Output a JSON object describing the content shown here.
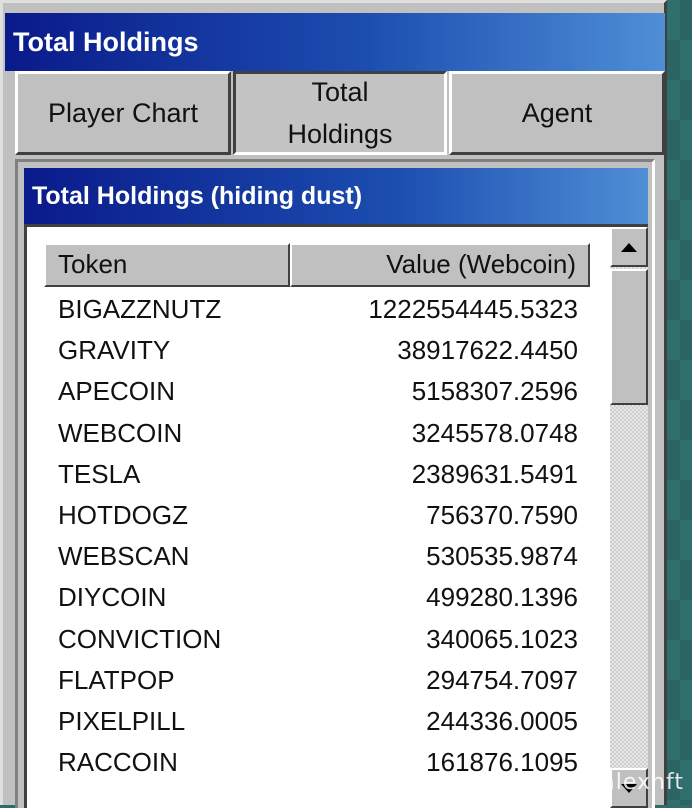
{
  "window": {
    "title": "Total Holdings"
  },
  "tabs": [
    {
      "label": "Player Chart"
    },
    {
      "label": "Total Holdings"
    },
    {
      "label": "Agent"
    }
  ],
  "panel": {
    "title": "Total Holdings (hiding dust)"
  },
  "table": {
    "columns": [
      "Token",
      "Value (Webcoin)"
    ],
    "rows": [
      {
        "token": "BIGAZZNUTZ",
        "value": "1222554445.5323"
      },
      {
        "token": "GRAVITY",
        "value": "38917622.4450"
      },
      {
        "token": "APECOIN",
        "value": "5158307.2596"
      },
      {
        "token": "WEBCOIN",
        "value": "3245578.0748"
      },
      {
        "token": "TESLA",
        "value": "2389631.5491"
      },
      {
        "token": "HOTDOGZ",
        "value": "756370.7590"
      },
      {
        "token": "WEBSCAN",
        "value": "530535.9874"
      },
      {
        "token": "DIYCOIN",
        "value": "499280.1396"
      },
      {
        "token": "CONVICTION",
        "value": "340065.1023"
      },
      {
        "token": "FLATPOP",
        "value": "294754.7097"
      },
      {
        "token": "PIXELPILL",
        "value": "244336.0005"
      },
      {
        "token": "RACCOIN",
        "value": "161876.1095"
      }
    ]
  },
  "scrollbar": {
    "up_icon": "triangle-up-icon",
    "down_icon": "triangle-down-icon"
  },
  "watermark": {
    "text": "@ natealexnft"
  }
}
